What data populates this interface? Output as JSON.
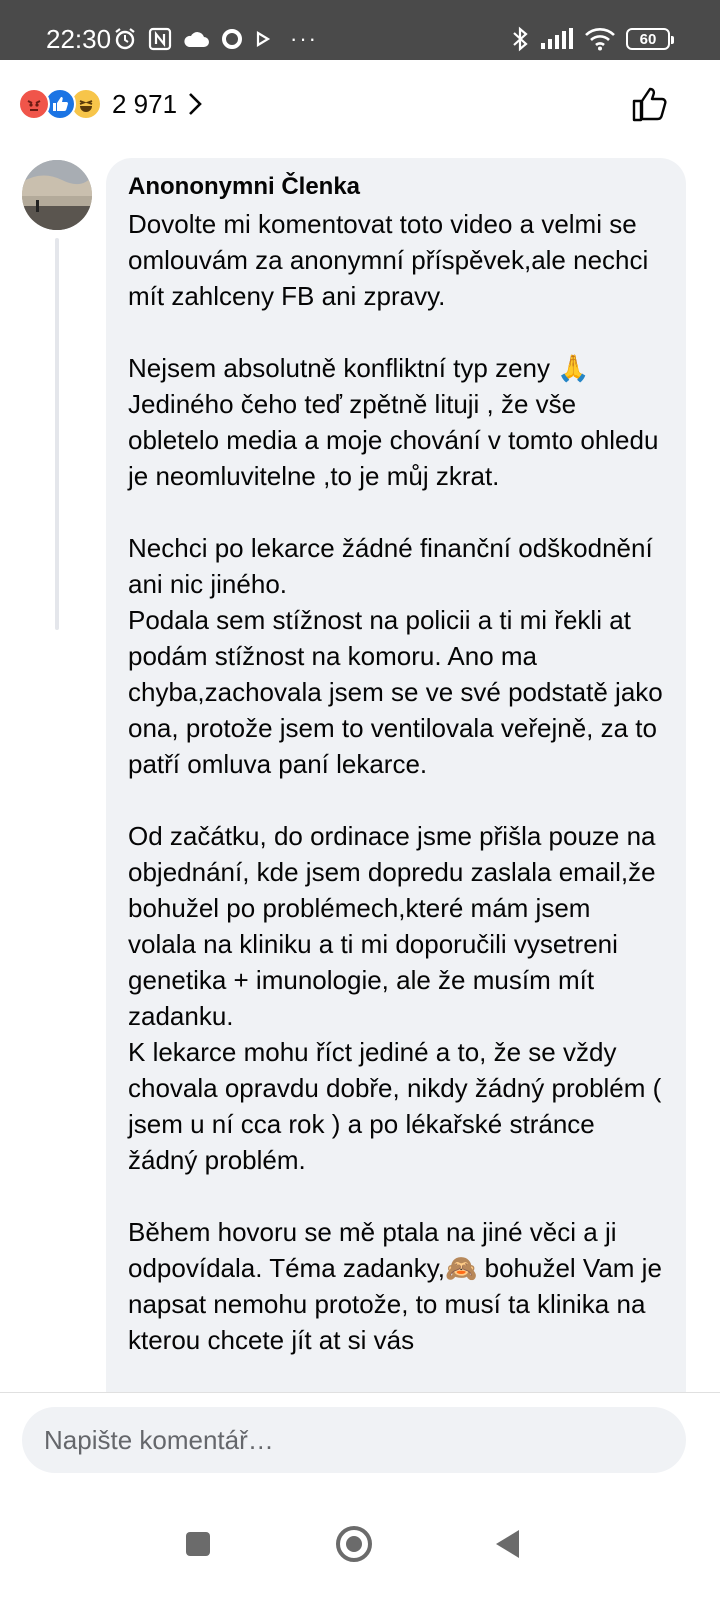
{
  "status_bar": {
    "time": "22:30",
    "battery": "60",
    "left_icons": [
      "alarm-icon",
      "nfc-icon",
      "cloud-icon",
      "circle-icon",
      "play-icon"
    ],
    "overflow": "···",
    "right_icons": [
      "bluetooth-icon",
      "signal-icon",
      "wifi-icon"
    ]
  },
  "reactions": {
    "types": [
      "angry",
      "like",
      "haha"
    ],
    "count": "2 971"
  },
  "comment": {
    "author": "Anononymni Členka",
    "text": "Dovolte mi komentovat toto video a velmi se omlouvám za anonymní příspěvek,ale nechci mít zahlceny FB ani zpravy.\n\nNejsem absolutně konfliktní typ zeny 🙏 Jediného čeho teď zpětně lituji , že vše obletelo media a moje chování v tomto ohledu je neomluvitelne ,to je můj zkrat.\n\nNechci po lekarce žádné finanční odškodnění ani nic jiného.\nPodala sem stížnost na policii a ti mi řekli at podám stížnost na komoru. Ano ma chyba,zachovala jsem se ve své podstatě jako ona, protože jsem to ventilovala veřejně, za to patří omluva paní lekarce.\n\nOd začátku, do ordinace jsme přišla pouze na objednání, kde jsem dopredu zaslala email,že bohužel po problémech,které mám jsem volala na kliniku a ti mi doporučili vysetreni genetika + imunologie, ale že musím mít zadanku.\nK lekarce mohu říct jediné a to, že se vždy chovala opravdu dobře, nikdy žádný problém ( jsem u ní cca rok ) a po lékařské stránce žádný problém.\n\nBěhem hovoru se mě ptala na jiné věci a ji odpovídala. Téma zadanky,🙈 bohužel Vam je napsat nemohu protože, to musí ta klinika na kterou chcete jít at si vás"
  },
  "composer": {
    "placeholder": "Napište komentář…"
  },
  "colors": {
    "status_bar_bg": "#4a4a4a",
    "bubble_bg": "#f0f2f5",
    "like_blue": "#1b74e4",
    "angry_red": "#f0554a",
    "haha_yellow": "#f7c54a"
  }
}
